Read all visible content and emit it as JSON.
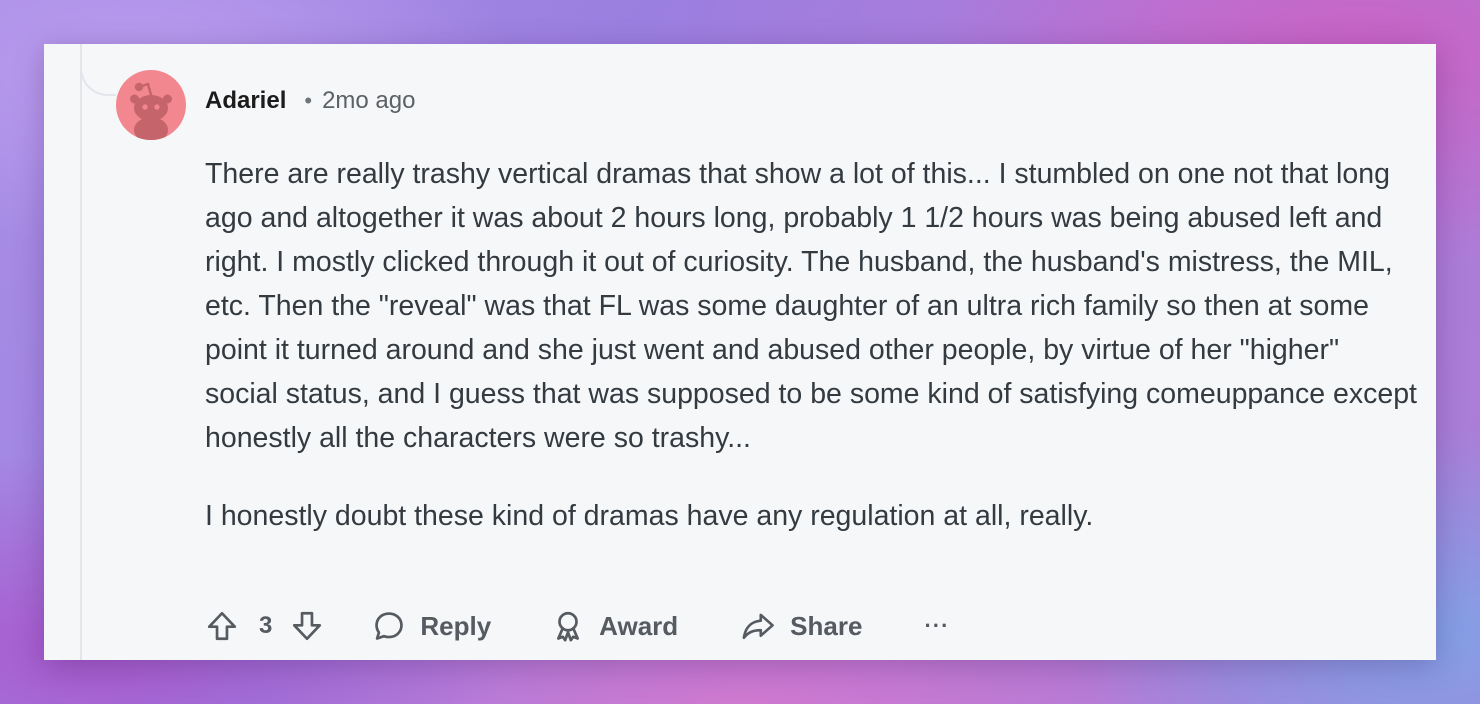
{
  "comment": {
    "author": "Adariel",
    "separator": "•",
    "time_ago": "2mo ago",
    "paragraphs": [
      "There are really trashy vertical dramas that show a lot of this... I stumbled on one not that long ago and altogether it was about 2 hours long, probably 1 1/2 hours was being abused left and right. I mostly clicked through it out of curiosity. The husband, the husband's mistress, the MIL, etc. Then the \"reveal\" was that FL was some daughter of an ultra rich family so then at some point it turned around and she just went and abused other people, by virtue of her \"higher\" social status, and I guess that was supposed to be some kind of satisfying comeuppance except honestly all the characters were so trashy...",
      "I honestly doubt these kind of dramas have any regulation at all, really."
    ]
  },
  "actions": {
    "vote_count": "3",
    "reply_label": "Reply",
    "award_label": "Award",
    "share_label": "Share",
    "more_label": "···"
  },
  "icons": {
    "avatar": "snoo-avatar-icon",
    "upvote": "upvote-arrow-icon",
    "downvote": "downvote-arrow-icon",
    "reply": "speech-bubble-icon",
    "award": "award-ribbon-icon",
    "share": "share-arrow-icon"
  },
  "colors": {
    "avatar_bg": "#f2878f",
    "card_bg": "#f6f7f9",
    "text": "#333a40",
    "muted": "#555b61"
  }
}
